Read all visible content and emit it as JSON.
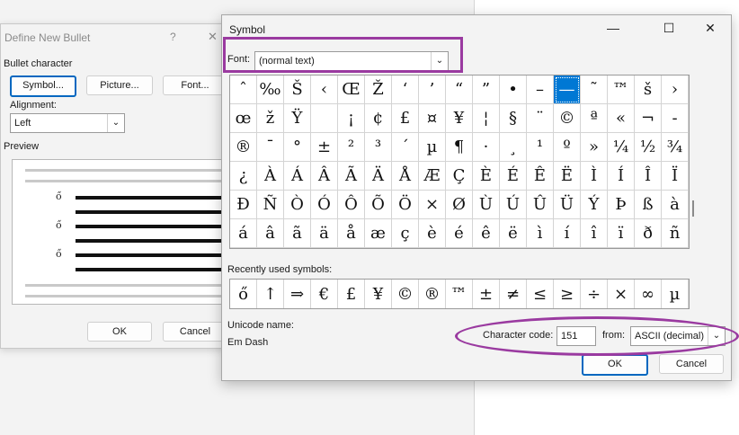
{
  "bullet_dialog": {
    "title": "Define New Bullet",
    "help_glyph": "?",
    "close_glyph": "✕",
    "section_label": "Bullet character",
    "buttons": [
      "Symbol...",
      "Picture...",
      "Font..."
    ],
    "alignment_label": "Alignment:",
    "alignment_value": "Left",
    "preview_label": "Preview",
    "bullet_symbol": "ő",
    "ok_label": "OK",
    "cancel_label": "Cancel"
  },
  "symbol_dialog": {
    "title": "Symbol",
    "minimize_glyph": "—",
    "maximize_glyph": "☐",
    "close_glyph": "✕",
    "font_label": "Font:",
    "font_value": "(normal text)",
    "grid_rows": [
      [
        "ˆ",
        "‰",
        "Š",
        "‹",
        "Œ",
        "Ž",
        "‘",
        "’",
        "“",
        "”",
        "•",
        "–",
        "—",
        "˜",
        "™",
        "š",
        "›"
      ],
      [
        "œ",
        "ž",
        "Ÿ",
        " ",
        "¡",
        "¢",
        "£",
        "¤",
        "¥",
        "¦",
        "§",
        "¨",
        "©",
        "ª",
        "«",
        "¬",
        "-"
      ],
      [
        "®",
        "¯",
        "°",
        "±",
        "²",
        "³",
        "´",
        "µ",
        "¶",
        "·",
        "¸",
        "¹",
        "º",
        "»",
        "¼",
        "½",
        "¾"
      ],
      [
        "¿",
        "À",
        "Á",
        "Â",
        "Ã",
        "Ä",
        "Å",
        "Æ",
        "Ç",
        "È",
        "É",
        "Ê",
        "Ë",
        "Ì",
        "Í",
        "Î",
        "Ï"
      ],
      [
        "Ð",
        "Ñ",
        "Ò",
        "Ó",
        "Ô",
        "Õ",
        "Ö",
        "×",
        "Ø",
        "Ù",
        "Ú",
        "Û",
        "Ü",
        "Ý",
        "Þ",
        "ß",
        "à"
      ],
      [
        "á",
        "â",
        "ã",
        "ä",
        "å",
        "æ",
        "ç",
        "è",
        "é",
        "ê",
        "ë",
        "ì",
        "í",
        "î",
        "ï",
        "ð",
        "ñ"
      ]
    ],
    "selected_index": [
      0,
      12
    ],
    "recent_label": "Recently used symbols:",
    "recent_symbols": [
      "ő",
      "↑",
      "⇒",
      "€",
      "£",
      "¥",
      "©",
      "®",
      "™",
      "±",
      "≠",
      "≤",
      "≥",
      "÷",
      "×",
      "∞",
      "µ"
    ],
    "unicode_name_label": "Unicode name:",
    "unicode_name_value": "Em Dash",
    "char_code_label": "Character code:",
    "char_code_value": "151",
    "from_label": "from:",
    "from_value": "ASCII (decimal)",
    "ok_label": "OK",
    "cancel_label": "Cancel"
  },
  "colors": {
    "highlight": "#9a3aa0",
    "selection": "#0078d4"
  }
}
